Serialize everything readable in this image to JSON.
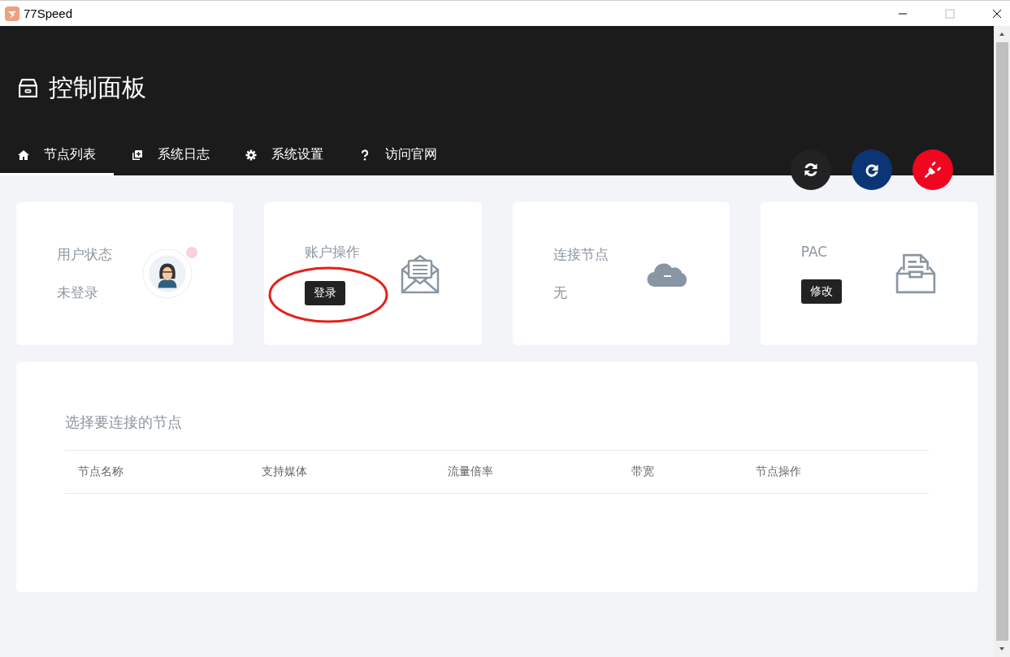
{
  "window": {
    "title": "77Speed"
  },
  "header": {
    "title": "控制面板"
  },
  "tabs": [
    {
      "label": "节点列表",
      "selected": true
    },
    {
      "label": "系统日志",
      "selected": false
    },
    {
      "label": "系统设置",
      "selected": false
    },
    {
      "label": "访问官网",
      "selected": false
    }
  ],
  "actions": [
    {
      "kind": "sync",
      "color": "#222222"
    },
    {
      "kind": "reload",
      "color": "#0b3575"
    },
    {
      "kind": "plug",
      "color": "#f0061e"
    }
  ],
  "cards": [
    {
      "label": "用户状态",
      "kind": "text",
      "value": "未登录"
    },
    {
      "label": "账户操作",
      "kind": "button",
      "value": "登录",
      "circled": true
    },
    {
      "label": "连接节点",
      "kind": "text",
      "value": "无"
    },
    {
      "label": "PAC",
      "kind": "button",
      "value": "修改"
    }
  ],
  "nodes": {
    "title": "选择要连接的节点",
    "columns": [
      "节点名称",
      "支持媒体",
      "流量倍率",
      "带宽",
      "节点操作"
    ]
  }
}
